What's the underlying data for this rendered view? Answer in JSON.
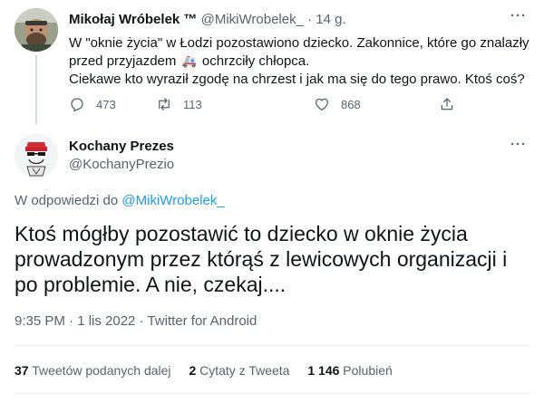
{
  "parent": {
    "display_name": "Mikołaj Wróbelek ™",
    "handle": "@MikiWrobelek_",
    "separator": "·",
    "time_ago": "14 g.",
    "text_line1": "W \"oknie życia\" w Łodzi pozostawiono dziecko. Zakonnice, które go znalazły",
    "text_line2a": "przed przyjazdem",
    "text_emoji": "🚑",
    "text_line2b": "ochrzciły chłopca.",
    "text_line3": "Ciekawe kto wyraził zgodę na chrzest i jak ma się do tego prawo. Ktoś coś?",
    "reply_count": "473",
    "retweet_count": "113",
    "like_count": "868",
    "more_label": "···"
  },
  "tweet": {
    "display_name": "Kochany Prezes",
    "handle": "@KochanyPrezio",
    "more_label": "···",
    "reply_prefix": "W odpowiedzi do",
    "reply_handle": "@MikiWrobelek_",
    "text_line1": "Ktoś mógłby pozostawić to dziecko w oknie życia",
    "text_line2": "prowadzonym przez którąś z lewicowych organizacji i",
    "text_line3": "po problemie. A nie, czekaj....",
    "meta": "9:35 PM · 1 lis 2022 · Twitter for Android",
    "stats": {
      "retweets_value": "37",
      "retweets_label": "Tweetów podanych dalej",
      "quotes_value": "2",
      "quotes_label": "Cytaty z Tweeta",
      "likes_value": "1 146",
      "likes_label": "Polubień"
    }
  },
  "colors": {
    "text": "#0f1419",
    "secondary": "#536471",
    "link": "#1d9bf0",
    "border": "#eff3f4"
  },
  "icons": [
    "reply-icon",
    "retweet-icon",
    "like-icon",
    "share-icon",
    "more-icon",
    "ambulance-icon"
  ]
}
